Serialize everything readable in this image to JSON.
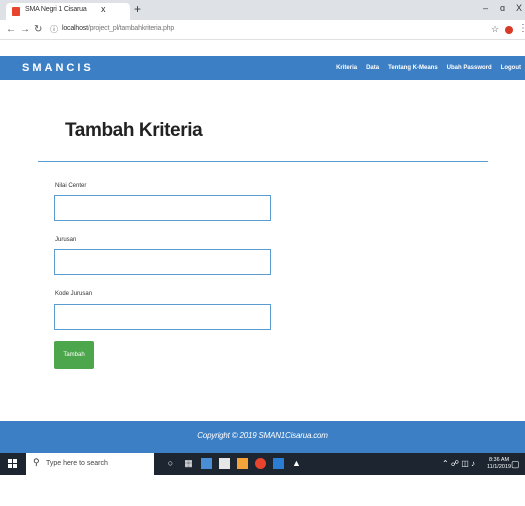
{
  "browser": {
    "tab_title": "SMA Negri 1 Cisarua",
    "tab_close": "x",
    "new_tab": "+",
    "url_host": "localhost",
    "url_path": "/project_pl/tambahkriteria.php",
    "win_minimize": "–",
    "win_maximize": "ɑ",
    "win_close": "X"
  },
  "navbar": {
    "brand": "SMANCIS",
    "links": [
      "Kriteria",
      "Data",
      "Tentang K-Means",
      "Ubah Password",
      "Logout"
    ]
  },
  "main": {
    "title": "Tambah Kriteria",
    "fields": [
      {
        "label": "Nilai Center",
        "value": ""
      },
      {
        "label": "Jurusan",
        "value": ""
      },
      {
        "label": "Kode Jurusan",
        "value": ""
      }
    ],
    "submit_label": "Tambah"
  },
  "footer": {
    "text": "Copyright © 2019 SMAN1Cisarua.com"
  },
  "taskbar": {
    "search_placeholder": "Type here to search",
    "time": "8:36 AM",
    "date": "11/1/2019"
  },
  "colors": {
    "navbar": "#3d7fc4",
    "button": "#4ca64c",
    "input_border": "#5a9bd0"
  }
}
